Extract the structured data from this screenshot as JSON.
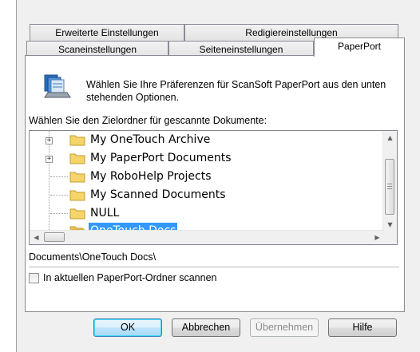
{
  "tabs": {
    "row_top": [
      "Erweiterte Einstellungen",
      "Redigiereinstellungen"
    ],
    "row_bottom": [
      "Scaneinstellungen",
      "Seiteneinstellungen",
      "PaperPort"
    ],
    "active": "PaperPort"
  },
  "intro_text": "Wählen Sie Ihre Präferenzen für ScanSoft PaperPort aus den unten stehenden Optionen.",
  "folder_label": "Wählen Sie den Zielordner für gescannte Dokumente:",
  "folders": [
    {
      "label": "My OneTouch Archive",
      "expandable": true,
      "selected": false
    },
    {
      "label": "My PaperPort Documents",
      "expandable": true,
      "selected": false
    },
    {
      "label": "My RoboHelp Projects",
      "expandable": false,
      "selected": false
    },
    {
      "label": "My Scanned Documents",
      "expandable": false,
      "selected": false
    },
    {
      "label": "NULL",
      "expandable": false,
      "selected": false
    },
    {
      "label": "OneTouch Docs",
      "expandable": false,
      "selected": true
    }
  ],
  "selected_path": "Documents\\OneTouch Docs\\",
  "checkbox": {
    "label": "In aktuellen PaperPort-Ordner scannen",
    "checked": false
  },
  "buttons": {
    "ok": "OK",
    "cancel": "Abbrechen",
    "apply": "Übernehmen",
    "help": "Hilfe"
  },
  "colors": {
    "selection": "#3399ff",
    "folder": "#f5d46b",
    "dialog_bg": "#f0f0f0"
  },
  "icons": {
    "app": "paperport-scanner-icon",
    "folder": "folder-icon",
    "open_folder": "open-folder-icon"
  }
}
